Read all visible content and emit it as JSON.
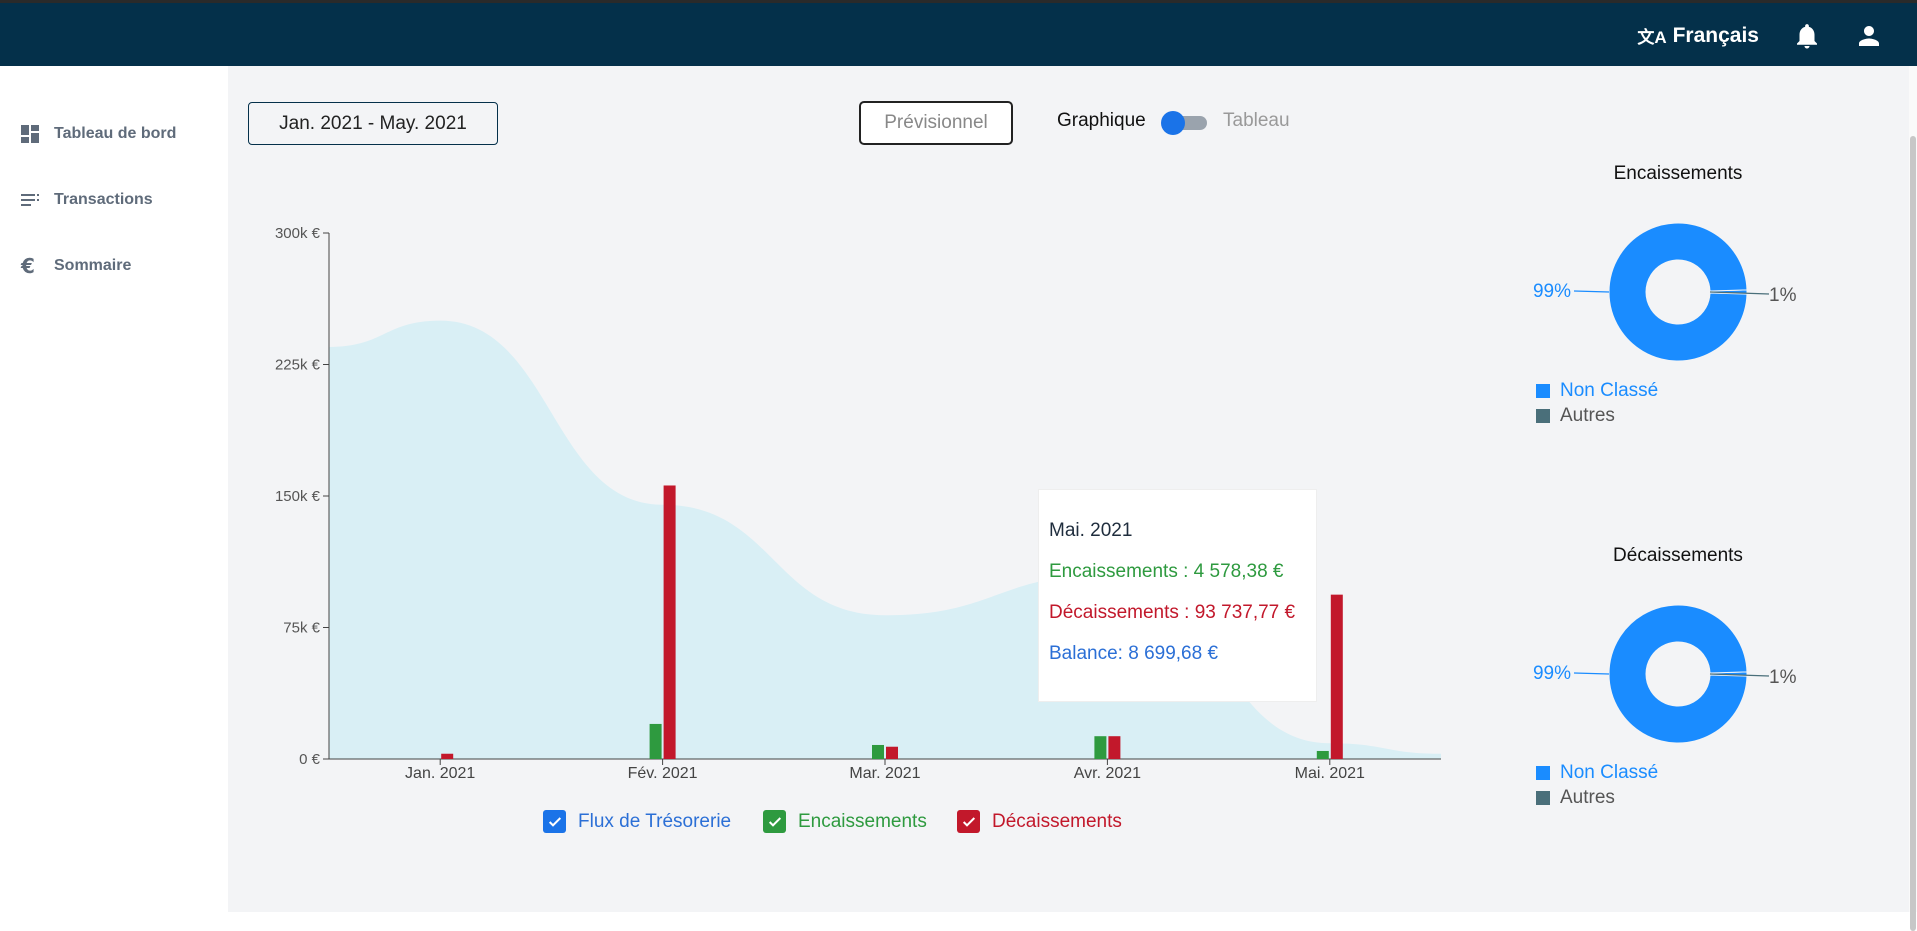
{
  "header": {
    "language_label": "Français",
    "language_icon": "translate-icon",
    "bell_icon": "bell-icon",
    "user_icon": "user-icon"
  },
  "sidebar": {
    "items": [
      {
        "label": "Tableau de bord",
        "icon": "dashboard-icon"
      },
      {
        "label": "Transactions",
        "icon": "list-icon"
      },
      {
        "label": "Sommaire",
        "icon": "euro-icon"
      }
    ]
  },
  "toolbar": {
    "date_range": "Jan. 2021 - May. 2021",
    "forecast_label": "Prévisionnel",
    "view_left": "Graphique",
    "view_right": "Tableau"
  },
  "tooltip": {
    "title": "Mai. 2021",
    "encaissements": "Encaissements : 4 578,38 €",
    "decaissements": "Décaissements : 93 737,77 €",
    "balance": "Balance: 8 699,68 €"
  },
  "legend": {
    "flux": "Flux de Trésorerie",
    "enc": "Encaissements",
    "dec": "Décaissements"
  },
  "colors": {
    "header_bg": "#04304a",
    "flux": "#1a73e8",
    "area": "#d9eff5",
    "encaissements": "#2e9a3f",
    "decaissements": "#c2182b",
    "donut_main": "#1a8cff",
    "donut_other": "#4a6f7a"
  },
  "chart_data": [
    {
      "type": "bar",
      "categories": [
        "Jan. 2021",
        "Fév. 2021",
        "Mar. 2021",
        "Avr. 2021",
        "Mai. 2021"
      ],
      "y_ticks": [
        "0 €",
        "75k €",
        "150k €",
        "225k €",
        "300k €"
      ],
      "ylim": [
        0,
        300000
      ],
      "series": [
        {
          "name": "Encaissements",
          "values": [
            0,
            20000,
            8000,
            13000,
            4578.38
          ]
        },
        {
          "name": "Décaissements",
          "values": [
            3000,
            156000,
            7000,
            13000,
            93737.77
          ]
        },
        {
          "name": "Flux de Trésorerie",
          "kind": "area",
          "values": [
            250000,
            145000,
            82000,
            105000,
            9000
          ]
        }
      ]
    },
    {
      "type": "pie",
      "title": "Encaissements",
      "labels": [
        "Non Classé",
        "Autres"
      ],
      "values": [
        99,
        1
      ],
      "percent_labels": [
        "99%",
        "1%"
      ]
    },
    {
      "type": "pie",
      "title": "Décaissements",
      "labels": [
        "Non Classé",
        "Autres"
      ],
      "values": [
        99,
        1
      ],
      "percent_labels": [
        "99%",
        "1%"
      ]
    }
  ]
}
